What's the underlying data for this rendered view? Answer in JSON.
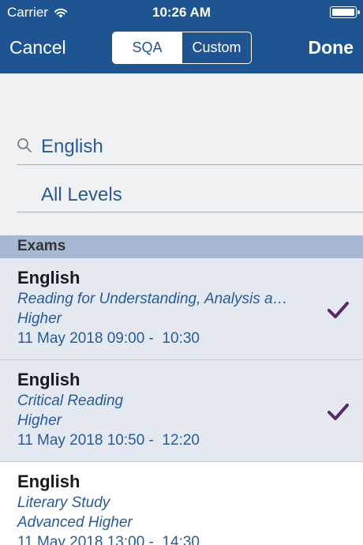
{
  "status_bar": {
    "carrier": "Carrier",
    "time": "10:26 AM"
  },
  "nav": {
    "cancel_label": "Cancel",
    "done_label": "Done",
    "segments": [
      "SQA",
      "Custom"
    ],
    "selected_segment": "SQA"
  },
  "search": {
    "query": "English",
    "level_filter": "All Levels"
  },
  "section": {
    "title": "Exams"
  },
  "exams": [
    {
      "subject": "English",
      "paper": "Reading for Understanding, Analysis a…",
      "level": "Higher",
      "time": "11 May 2018 09:00 -  10:30",
      "selected": true
    },
    {
      "subject": "English",
      "paper": "Critical Reading",
      "level": "Higher",
      "time": "11 May 2018 10:50 -  12:20",
      "selected": true
    },
    {
      "subject": "English",
      "paper": "Literary Study",
      "level": "Advanced Higher",
      "time": "11 May 2018 13:00 -  14:30",
      "selected": false
    }
  ],
  "colors": {
    "header_bg": "#1e5491",
    "section_header_bg": "#a7b9d2",
    "selected_row_bg": "#e4e9f1",
    "accent_text": "#2a5a96",
    "checkmark": "#5a2a66"
  },
  "icons": {
    "wifi": "wifi-icon",
    "battery": "battery-icon",
    "search": "search-icon",
    "check": "checkmark-icon"
  }
}
